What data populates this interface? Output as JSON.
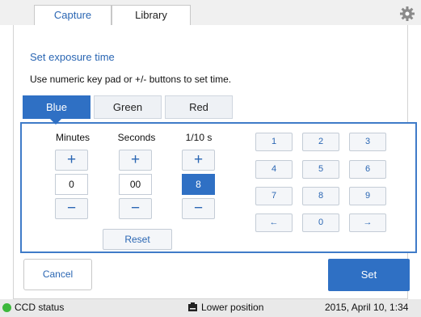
{
  "tabs": [
    {
      "label": "Capture",
      "active": true
    },
    {
      "label": "Library",
      "active": false
    }
  ],
  "settings_icon": "gear-icon",
  "heading": "Set exposure time",
  "instruction": "Use numeric key pad or +/- buttons to set time.",
  "channels": [
    {
      "label": "Blue",
      "active": true
    },
    {
      "label": "Green",
      "active": false
    },
    {
      "label": "Red",
      "active": false
    }
  ],
  "time": {
    "minutes": {
      "label": "Minutes",
      "value": "0"
    },
    "seconds": {
      "label": "Seconds",
      "value": "00"
    },
    "tenths": {
      "label": "1/10 s",
      "value": "8",
      "selected": true
    },
    "plus_symbol": "+",
    "minus_symbol": "−"
  },
  "reset_label": "Reset",
  "keypad": [
    "1",
    "2",
    "3",
    "4",
    "5",
    "6",
    "7",
    "8",
    "9",
    "←",
    "0",
    "→"
  ],
  "cancel_label": "Cancel",
  "set_label": "Set",
  "status": {
    "ccd": "CCD status",
    "position": "Lower position",
    "date": "2015, April 10, 1:34"
  },
  "colors": {
    "accent": "#2f70c4",
    "status_ok": "#3cb83c"
  }
}
